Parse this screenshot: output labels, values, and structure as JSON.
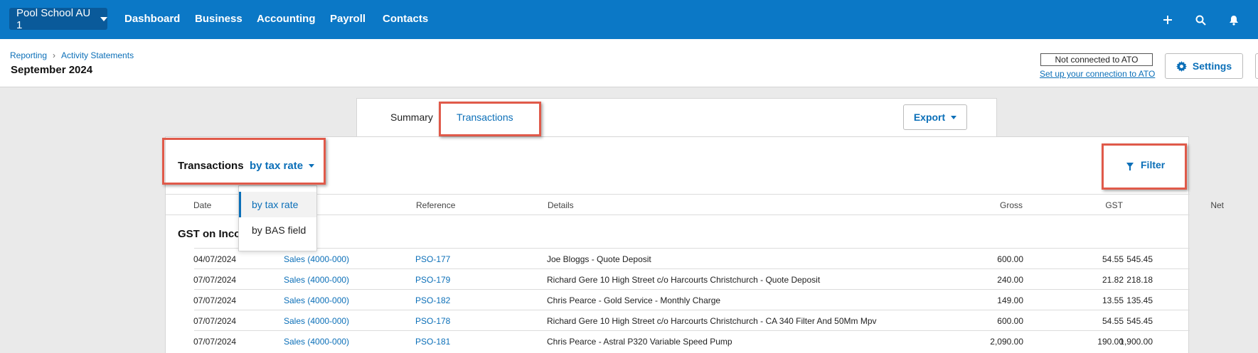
{
  "nav": {
    "org": "Pool School AU 1",
    "items": [
      "Dashboard",
      "Business",
      "Accounting",
      "Payroll",
      "Contacts"
    ],
    "icons": [
      "plus-icon",
      "search-icon",
      "bell-icon"
    ]
  },
  "header": {
    "breadcrumb": [
      "Reporting",
      "Activity Statements"
    ],
    "title": "September 2024",
    "ato_status": "Not connected to ATO",
    "ato_link": "Set up your connection to ATO",
    "settings_label": "Settings"
  },
  "tabs": {
    "summary": "Summary",
    "transactions": "Transactions",
    "export": "Export"
  },
  "panel": {
    "title": "Transactions",
    "view": "by tax rate",
    "filter": "Filter",
    "dropdown": [
      "by tax rate",
      "by BAS field"
    ],
    "columns": {
      "date": "Date",
      "reference": "Reference",
      "details": "Details",
      "gross": "Gross",
      "gst": "GST",
      "net": "Net"
    },
    "group": "GST on Inco",
    "rows": [
      {
        "date": "04/07/2024",
        "account": "Sales (4000-000)",
        "ref": "PSO-177",
        "details": "Joe Bloggs - Quote Deposit",
        "gross": "600.00",
        "gst": "54.55",
        "net": "545.45"
      },
      {
        "date": "07/07/2024",
        "account": "Sales (4000-000)",
        "ref": "PSO-179",
        "details": "Richard Gere 10 High Street c/o Harcourts Christchurch - Quote Deposit",
        "gross": "240.00",
        "gst": "21.82",
        "net": "218.18"
      },
      {
        "date": "07/07/2024",
        "account": "Sales (4000-000)",
        "ref": "PSO-182",
        "details": "Chris Pearce - Gold Service - Monthly Charge",
        "gross": "149.00",
        "gst": "13.55",
        "net": "135.45"
      },
      {
        "date": "07/07/2024",
        "account": "Sales (4000-000)",
        "ref": "PSO-178",
        "details": "Richard Gere 10 High Street c/o Harcourts Christchurch - CA 340 Filter And 50Mm Mpv",
        "gross": "600.00",
        "gst": "54.55",
        "net": "545.45"
      },
      {
        "date": "07/07/2024",
        "account": "Sales (4000-000)",
        "ref": "PSO-181",
        "details": "Chris Pearce - Astral P320 Variable Speed Pump",
        "gross": "2,090.00",
        "gst": "190.00",
        "net": "1,900.00"
      }
    ]
  },
  "colors": {
    "nav": "#0b78c6",
    "accent": "#0b6fb8",
    "highlight": "#e05a4a"
  }
}
